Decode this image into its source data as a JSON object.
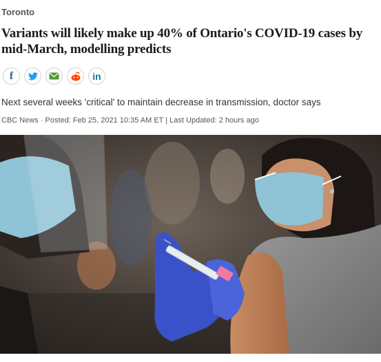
{
  "section": "Toronto",
  "headline": "Variants will likely make up 40% of Ontario's COVID-19 cases by mid-March, modelling predicts",
  "share": [
    {
      "icon": "facebook-icon",
      "glyph": "f"
    },
    {
      "icon": "twitter-icon",
      "glyph": ""
    },
    {
      "icon": "email-icon",
      "glyph": ""
    },
    {
      "icon": "reddit-icon",
      "glyph": ""
    },
    {
      "icon": "linkedin-icon",
      "glyph": "in"
    }
  ],
  "subtitle": "Next several weeks 'critical' to maintain decrease in transmission, doctor says",
  "byline": "CBC News · Posted: Feb 25, 2021 10:35 AM ET | Last Updated: 2 hours ago",
  "colors": {
    "glove": "#3a52c9",
    "mask": "#8fc3d6",
    "shirt": "#8a8a8a"
  }
}
